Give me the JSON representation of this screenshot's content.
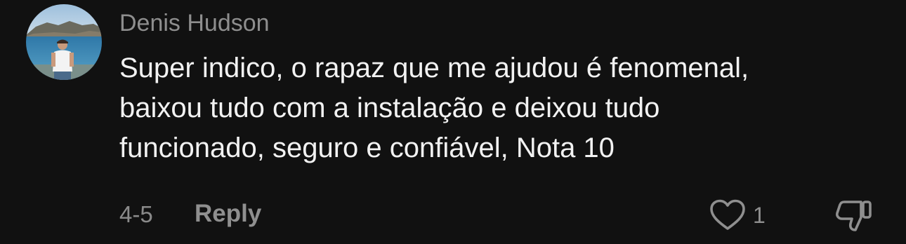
{
  "comment": {
    "author": "Denis Hudson",
    "text_lines": [
      "Super indico, o rapaz que me ajudou é fenomenal,",
      "baixou tudo com a instalação e deixou tudo",
      "funcionado, seguro e confiável, Nota 10"
    ],
    "date": "4-5",
    "reply_label": "Reply",
    "like_count": "1"
  },
  "icons": {
    "like": "heart-icon",
    "dislike": "thumbs-down-icon"
  },
  "colors": {
    "background": "#111111",
    "text_primary": "#f2f2f2",
    "text_secondary": "#8e8e8e"
  }
}
